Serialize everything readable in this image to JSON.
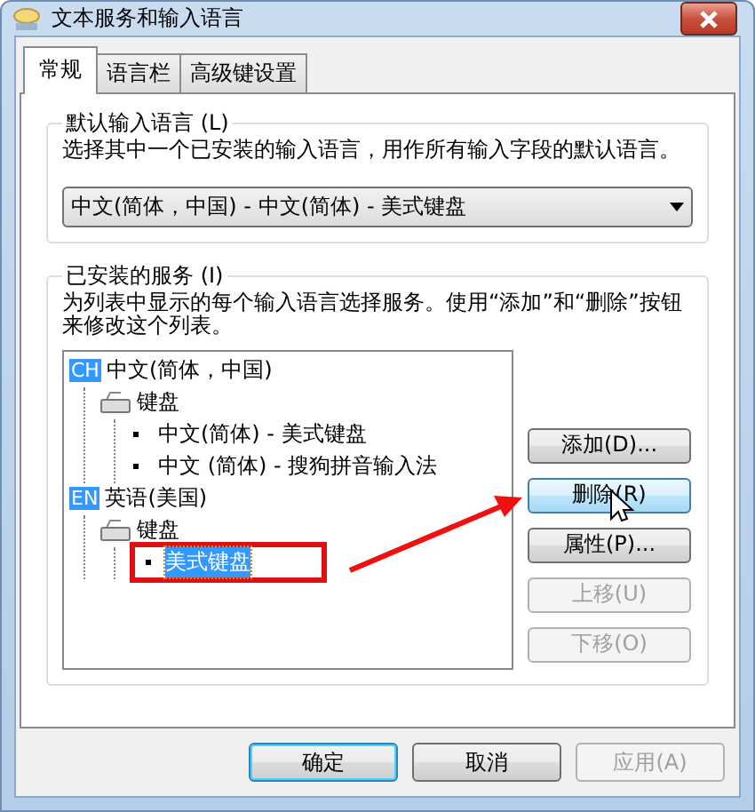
{
  "window": {
    "title": "文本服务和输入语言"
  },
  "tabs": [
    {
      "label": "常规",
      "selected": true
    },
    {
      "label": "语言栏",
      "selected": false
    },
    {
      "label": "高级键设置",
      "selected": false
    }
  ],
  "default_language": {
    "title": "默认输入语言 (L)",
    "description": "选择其中一个已安装的输入语言，用作所有输入字段的默认语言。",
    "dropdown_value": "中文(简体，中国) - 中文(简体) - 美式键盘"
  },
  "installed_services": {
    "title": "已安装的服务 (I)",
    "description": "为列表中显示的每个输入语言选择服务。使用“添加”和“删除”按钮来修改这个列表。",
    "tree": [
      {
        "kind": "language",
        "badge": "CH",
        "label": "中文(简体，中国)",
        "selected": false,
        "children": [
          {
            "kind": "category",
            "label": "键盘",
            "selected": false,
            "children": [
              {
                "kind": "service",
                "label": "中文(简体) - 美式键盘",
                "selected": false
              },
              {
                "kind": "service",
                "label": "中文 (简体) - 搜狗拼音输入法",
                "selected": false
              }
            ]
          }
        ]
      },
      {
        "kind": "language",
        "badge": "EN",
        "label": "英语(美国)",
        "selected": false,
        "children": [
          {
            "kind": "category",
            "label": "键盘",
            "selected": false,
            "children": [
              {
                "kind": "service",
                "label": "美式键盘",
                "selected": true
              }
            ]
          }
        ]
      }
    ],
    "buttons": [
      {
        "label": "添加(D)...",
        "disabled": false,
        "hovered": false
      },
      {
        "label": "删除(R)",
        "disabled": false,
        "hovered": true
      },
      {
        "label": "属性(P)...",
        "disabled": false,
        "hovered": false
      },
      {
        "label": "上移(U)",
        "disabled": true,
        "hovered": false
      },
      {
        "label": "下移(O)",
        "disabled": true,
        "hovered": false
      }
    ]
  },
  "footer_buttons": [
    {
      "label": "确定",
      "disabled": false,
      "default": true
    },
    {
      "label": "取消",
      "disabled": false,
      "default": false
    },
    {
      "label": "应用(A)",
      "disabled": true,
      "default": false
    }
  ]
}
